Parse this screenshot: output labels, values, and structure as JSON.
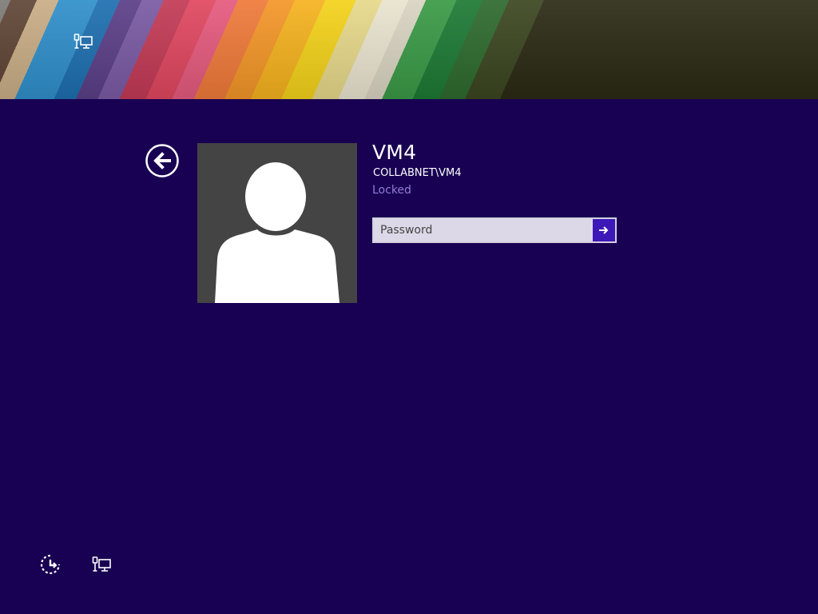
{
  "user": {
    "name": "VM4",
    "account": "COLLABNET\\VM4",
    "status": "Locked"
  },
  "password": {
    "placeholder": "Password",
    "value": ""
  },
  "icons": {
    "top_network": "network-icon",
    "back": "back-arrow-icon",
    "avatar": "user-silhouette-icon",
    "submit": "arrow-right-icon",
    "ease_of_access": "ease-of-access-icon",
    "bottom_network": "network-icon"
  },
  "colors": {
    "background": "#180052",
    "submit_button": "#3d18b8",
    "status_text": "#8f7fd6",
    "avatar_tile": "#444444"
  }
}
